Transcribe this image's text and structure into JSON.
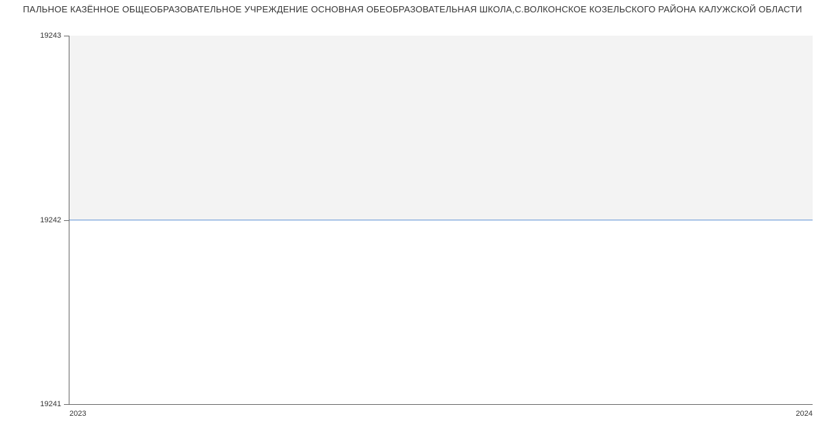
{
  "chart_data": {
    "type": "line",
    "title": "ПАЛЬНОЕ КАЗЁННОЕ ОБЩЕОБРАЗОВАТЕЛЬНОЕ УЧРЕЖДЕНИЕ ОСНОВНАЯ ОБЕОБРАЗОВАТЕЛЬНАЯ ШКОЛА,С.ВОЛКОНСКОЕ КОЗЕЛЬСКОГО РАЙОНА КАЛУЖСКОЙ ОБЛАСТИ",
    "x": [
      2023,
      2024
    ],
    "series": [
      {
        "name": "value",
        "values": [
          19242,
          19242
        ]
      }
    ],
    "xlabel": "",
    "ylabel": "",
    "xlim": [
      2023,
      2024
    ],
    "ylim": [
      19241,
      19243
    ],
    "x_ticks": [
      "2023",
      "2024"
    ],
    "y_ticks": [
      "19241",
      "19242",
      "19243"
    ]
  }
}
